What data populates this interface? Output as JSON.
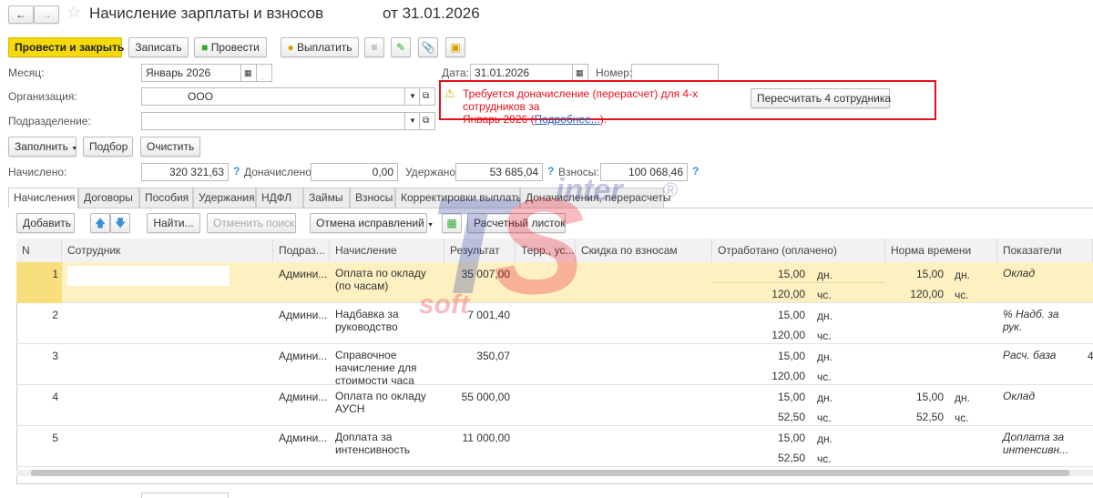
{
  "window": {
    "title": "Начисление зарплаты и взносов",
    "date_title": "от 31.01.2026"
  },
  "toolbar": {
    "post_close": "Провести и закрыть",
    "save": "Записать",
    "post": "Провести",
    "pay": "Выплатить"
  },
  "form": {
    "month_label": "Месяц:",
    "month_value": "Январь 2026",
    "date_label": "Дата:",
    "date_value": "31.01.2026",
    "number_label": "Номер:",
    "number_value": "",
    "org_label": "Организация:",
    "org_value": "ООО",
    "dept_label": "Подразделение:",
    "dept_value": ""
  },
  "warning": {
    "text": "Требуется доначисление (перерасчет) для 4-х сотрудников за",
    "text2": "Январь 2026 (",
    "link": "Подробнее...",
    "text3": ").",
    "button": "Пересчитать 4 сотрудника",
    "color": "#e8101c"
  },
  "actions": {
    "fill": "Заполнить",
    "select": "Подбор",
    "clear": "Очистить"
  },
  "totals": {
    "accrued_label": "Начислено:",
    "accrued": "320 321,63",
    "additional_label": "Доначислено:",
    "additional": "0,00",
    "withheld_label": "Удержано:",
    "withheld": "53 685,04",
    "contrib_label": "Взносы:",
    "contrib": "100 068,46"
  },
  "tabs": [
    "Начисления",
    "Договоры",
    "Пособия",
    "Удержания",
    "НДФЛ",
    "Займы",
    "Взносы",
    "Корректировки выплаты",
    "Доначисления, перерасчеты"
  ],
  "table_toolbar": {
    "add": "Добавить",
    "find": "Найти...",
    "cancel_search": "Отменить поиск",
    "cancel_fix": "Отмена исправлений",
    "payslip": "Расчетный листок"
  },
  "columns": [
    "N",
    "Сотрудник",
    "Подраз...",
    "Начисление",
    "Результат",
    "Терр., ус...",
    "Скидка по взносам",
    "Отработано (оплачено)",
    "Норма времени",
    "Показатели"
  ],
  "rows": [
    {
      "n": "1",
      "dept": "Админи...",
      "accrual": "Оплата по окладу (по часам)",
      "result": "35 007,00",
      "days": "15,00",
      "hours": "120,00",
      "norm_days": "15,00",
      "norm_hours": "120,00",
      "indicator": "Оклад",
      "extra": ""
    },
    {
      "n": "2",
      "dept": "Админи...",
      "accrual": "Надбавка за руководство",
      "result": "7 001,40",
      "days": "15,00",
      "hours": "120,00",
      "norm_days": "",
      "norm_hours": "",
      "indicator": "%  Надб. за рук.",
      "extra": ""
    },
    {
      "n": "3",
      "dept": "Админи...",
      "accrual": "Справочное начисление для стоимости часа",
      "result": "350,07",
      "days": "15,00",
      "hours": "120,00",
      "norm_days": "",
      "norm_hours": "",
      "indicator": "Расч. база",
      "extra": "4"
    },
    {
      "n": "4",
      "dept": "Админи...",
      "accrual": "Оплата по окладу АУСН",
      "result": "55 000,00",
      "days": "15,00",
      "hours": "52,50",
      "norm_days": "15,00",
      "norm_hours": "52,50",
      "indicator": "Оклад",
      "extra": ""
    },
    {
      "n": "5",
      "dept": "Админи...",
      "accrual": "Доплата за интенсивность",
      "result": "11 000,00",
      "days": "15,00",
      "hours": "52,50",
      "norm_days": "",
      "norm_hours": "",
      "indicator": "Доплата за интенсивн...",
      "extra": ""
    }
  ],
  "units": {
    "days": "дн.",
    "hours": "чс."
  },
  "watermark": {
    "text1": "inter",
    "text2": "TS",
    "text3": "soft"
  }
}
